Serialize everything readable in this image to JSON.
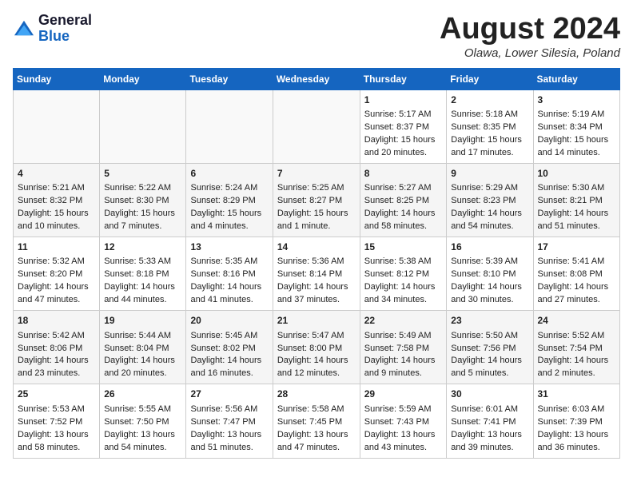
{
  "header": {
    "logo_line1": "General",
    "logo_line2": "Blue",
    "month_year": "August 2024",
    "location": "Olawa, Lower Silesia, Poland"
  },
  "days_of_week": [
    "Sunday",
    "Monday",
    "Tuesday",
    "Wednesday",
    "Thursday",
    "Friday",
    "Saturday"
  ],
  "weeks": [
    [
      {
        "day": "",
        "sunrise": "",
        "sunset": "",
        "daylight": ""
      },
      {
        "day": "",
        "sunrise": "",
        "sunset": "",
        "daylight": ""
      },
      {
        "day": "",
        "sunrise": "",
        "sunset": "",
        "daylight": ""
      },
      {
        "day": "",
        "sunrise": "",
        "sunset": "",
        "daylight": ""
      },
      {
        "day": "1",
        "sunrise": "Sunrise: 5:17 AM",
        "sunset": "Sunset: 8:37 PM",
        "daylight": "Daylight: 15 hours and 20 minutes."
      },
      {
        "day": "2",
        "sunrise": "Sunrise: 5:18 AM",
        "sunset": "Sunset: 8:35 PM",
        "daylight": "Daylight: 15 hours and 17 minutes."
      },
      {
        "day": "3",
        "sunrise": "Sunrise: 5:19 AM",
        "sunset": "Sunset: 8:34 PM",
        "daylight": "Daylight: 15 hours and 14 minutes."
      }
    ],
    [
      {
        "day": "4",
        "sunrise": "Sunrise: 5:21 AM",
        "sunset": "Sunset: 8:32 PM",
        "daylight": "Daylight: 15 hours and 10 minutes."
      },
      {
        "day": "5",
        "sunrise": "Sunrise: 5:22 AM",
        "sunset": "Sunset: 8:30 PM",
        "daylight": "Daylight: 15 hours and 7 minutes."
      },
      {
        "day": "6",
        "sunrise": "Sunrise: 5:24 AM",
        "sunset": "Sunset: 8:29 PM",
        "daylight": "Daylight: 15 hours and 4 minutes."
      },
      {
        "day": "7",
        "sunrise": "Sunrise: 5:25 AM",
        "sunset": "Sunset: 8:27 PM",
        "daylight": "Daylight: 15 hours and 1 minute."
      },
      {
        "day": "8",
        "sunrise": "Sunrise: 5:27 AM",
        "sunset": "Sunset: 8:25 PM",
        "daylight": "Daylight: 14 hours and 58 minutes."
      },
      {
        "day": "9",
        "sunrise": "Sunrise: 5:29 AM",
        "sunset": "Sunset: 8:23 PM",
        "daylight": "Daylight: 14 hours and 54 minutes."
      },
      {
        "day": "10",
        "sunrise": "Sunrise: 5:30 AM",
        "sunset": "Sunset: 8:21 PM",
        "daylight": "Daylight: 14 hours and 51 minutes."
      }
    ],
    [
      {
        "day": "11",
        "sunrise": "Sunrise: 5:32 AM",
        "sunset": "Sunset: 8:20 PM",
        "daylight": "Daylight: 14 hours and 47 minutes."
      },
      {
        "day": "12",
        "sunrise": "Sunrise: 5:33 AM",
        "sunset": "Sunset: 8:18 PM",
        "daylight": "Daylight: 14 hours and 44 minutes."
      },
      {
        "day": "13",
        "sunrise": "Sunrise: 5:35 AM",
        "sunset": "Sunset: 8:16 PM",
        "daylight": "Daylight: 14 hours and 41 minutes."
      },
      {
        "day": "14",
        "sunrise": "Sunrise: 5:36 AM",
        "sunset": "Sunset: 8:14 PM",
        "daylight": "Daylight: 14 hours and 37 minutes."
      },
      {
        "day": "15",
        "sunrise": "Sunrise: 5:38 AM",
        "sunset": "Sunset: 8:12 PM",
        "daylight": "Daylight: 14 hours and 34 minutes."
      },
      {
        "day": "16",
        "sunrise": "Sunrise: 5:39 AM",
        "sunset": "Sunset: 8:10 PM",
        "daylight": "Daylight: 14 hours and 30 minutes."
      },
      {
        "day": "17",
        "sunrise": "Sunrise: 5:41 AM",
        "sunset": "Sunset: 8:08 PM",
        "daylight": "Daylight: 14 hours and 27 minutes."
      }
    ],
    [
      {
        "day": "18",
        "sunrise": "Sunrise: 5:42 AM",
        "sunset": "Sunset: 8:06 PM",
        "daylight": "Daylight: 14 hours and 23 minutes."
      },
      {
        "day": "19",
        "sunrise": "Sunrise: 5:44 AM",
        "sunset": "Sunset: 8:04 PM",
        "daylight": "Daylight: 14 hours and 20 minutes."
      },
      {
        "day": "20",
        "sunrise": "Sunrise: 5:45 AM",
        "sunset": "Sunset: 8:02 PM",
        "daylight": "Daylight: 14 hours and 16 minutes."
      },
      {
        "day": "21",
        "sunrise": "Sunrise: 5:47 AM",
        "sunset": "Sunset: 8:00 PM",
        "daylight": "Daylight: 14 hours and 12 minutes."
      },
      {
        "day": "22",
        "sunrise": "Sunrise: 5:49 AM",
        "sunset": "Sunset: 7:58 PM",
        "daylight": "Daylight: 14 hours and 9 minutes."
      },
      {
        "day": "23",
        "sunrise": "Sunrise: 5:50 AM",
        "sunset": "Sunset: 7:56 PM",
        "daylight": "Daylight: 14 hours and 5 minutes."
      },
      {
        "day": "24",
        "sunrise": "Sunrise: 5:52 AM",
        "sunset": "Sunset: 7:54 PM",
        "daylight": "Daylight: 14 hours and 2 minutes."
      }
    ],
    [
      {
        "day": "25",
        "sunrise": "Sunrise: 5:53 AM",
        "sunset": "Sunset: 7:52 PM",
        "daylight": "Daylight: 13 hours and 58 minutes."
      },
      {
        "day": "26",
        "sunrise": "Sunrise: 5:55 AM",
        "sunset": "Sunset: 7:50 PM",
        "daylight": "Daylight: 13 hours and 54 minutes."
      },
      {
        "day": "27",
        "sunrise": "Sunrise: 5:56 AM",
        "sunset": "Sunset: 7:47 PM",
        "daylight": "Daylight: 13 hours and 51 minutes."
      },
      {
        "day": "28",
        "sunrise": "Sunrise: 5:58 AM",
        "sunset": "Sunset: 7:45 PM",
        "daylight": "Daylight: 13 hours and 47 minutes."
      },
      {
        "day": "29",
        "sunrise": "Sunrise: 5:59 AM",
        "sunset": "Sunset: 7:43 PM",
        "daylight": "Daylight: 13 hours and 43 minutes."
      },
      {
        "day": "30",
        "sunrise": "Sunrise: 6:01 AM",
        "sunset": "Sunset: 7:41 PM",
        "daylight": "Daylight: 13 hours and 39 minutes."
      },
      {
        "day": "31",
        "sunrise": "Sunrise: 6:03 AM",
        "sunset": "Sunset: 7:39 PM",
        "daylight": "Daylight: 13 hours and 36 minutes."
      }
    ]
  ]
}
